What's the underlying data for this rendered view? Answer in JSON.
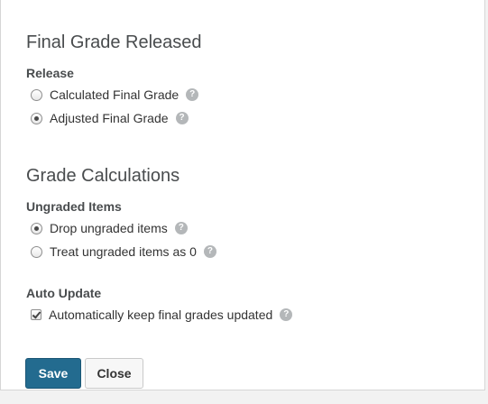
{
  "final_grade": {
    "title": "Final Grade Released",
    "release_label": "Release",
    "options": [
      {
        "label": "Calculated Final Grade",
        "checked": false
      },
      {
        "label": "Adjusted Final Grade",
        "checked": true
      }
    ]
  },
  "grade_calc": {
    "title": "Grade Calculations",
    "ungraded_label": "Ungraded Items",
    "options": [
      {
        "label": "Drop ungraded items",
        "checked": true
      },
      {
        "label": "Treat ungraded items as 0",
        "checked": false
      }
    ]
  },
  "auto_update": {
    "label": "Auto Update",
    "checkbox_label": "Automatically keep final grades updated",
    "checked": true
  },
  "help_glyph": "?",
  "buttons": {
    "save": "Save",
    "close": "Close"
  },
  "colors": {
    "primary": "#236b8f",
    "help_icon": "#b4b7b9"
  }
}
